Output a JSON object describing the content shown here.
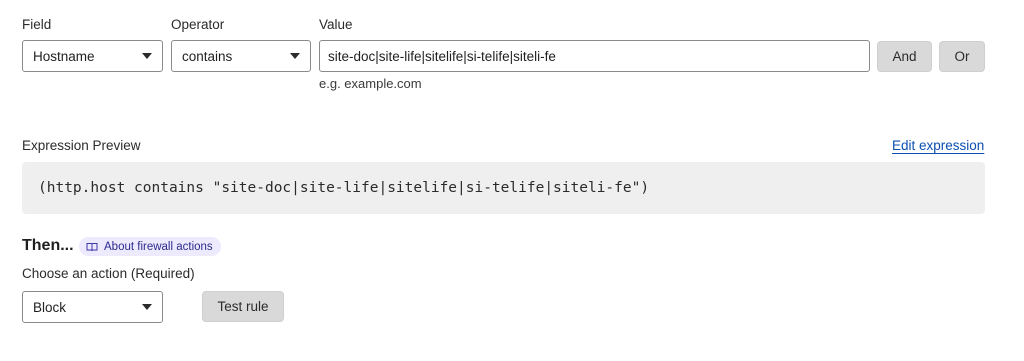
{
  "filter": {
    "field_label": "Field",
    "operator_label": "Operator",
    "value_label": "Value",
    "field_value": "Hostname",
    "operator_value": "contains",
    "value_text": "site-doc|site-life|sitelife|si-telife|siteli-fe",
    "value_hint": "e.g. example.com",
    "and_label": "And",
    "or_label": "Or"
  },
  "preview": {
    "title": "Expression Preview",
    "edit_link": "Edit expression",
    "expression": "(http.host contains \"site-doc|site-life|sitelife|si-telife|siteli-fe\")"
  },
  "action": {
    "then_label": "Then...",
    "about_link": "About firewall actions",
    "choose_label": "Choose an action (Required)",
    "selected": "Block",
    "test_label": "Test rule"
  },
  "icons": {
    "chevron": "chevron-down-icon",
    "book": "book-icon"
  }
}
